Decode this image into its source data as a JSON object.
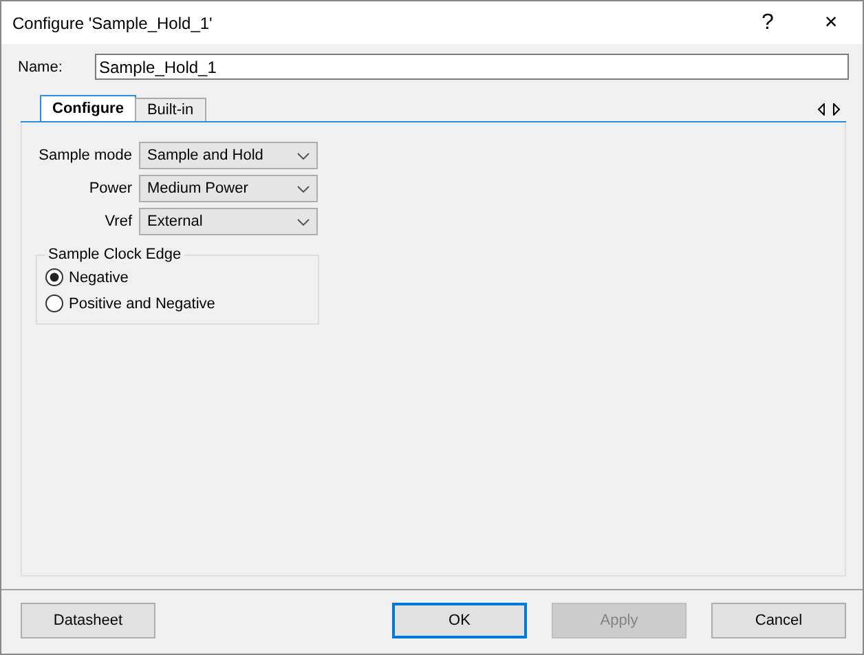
{
  "window": {
    "title": "Configure 'Sample_Hold_1'",
    "help": "?",
    "close": "×"
  },
  "name_field": {
    "label": "Name:",
    "value": "Sample_Hold_1"
  },
  "tabs": [
    {
      "label": "Configure",
      "selected": true
    },
    {
      "label": "Built-in",
      "selected": false
    }
  ],
  "fields": [
    {
      "label": "Sample mode",
      "value": "Sample and Hold"
    },
    {
      "label": "Power",
      "value": "Medium Power"
    },
    {
      "label": "Vref",
      "value": "External"
    }
  ],
  "group": {
    "title": "Sample Clock Edge",
    "options": [
      {
        "label": "Negative",
        "selected": true
      },
      {
        "label": "Positive and Negative",
        "selected": false
      }
    ]
  },
  "buttons": [
    {
      "label": "Datasheet",
      "kind": "normal"
    },
    {
      "label": "OK",
      "kind": "default"
    },
    {
      "label": "Apply",
      "kind": "disabled"
    },
    {
      "label": "Cancel",
      "kind": "normal"
    }
  ]
}
